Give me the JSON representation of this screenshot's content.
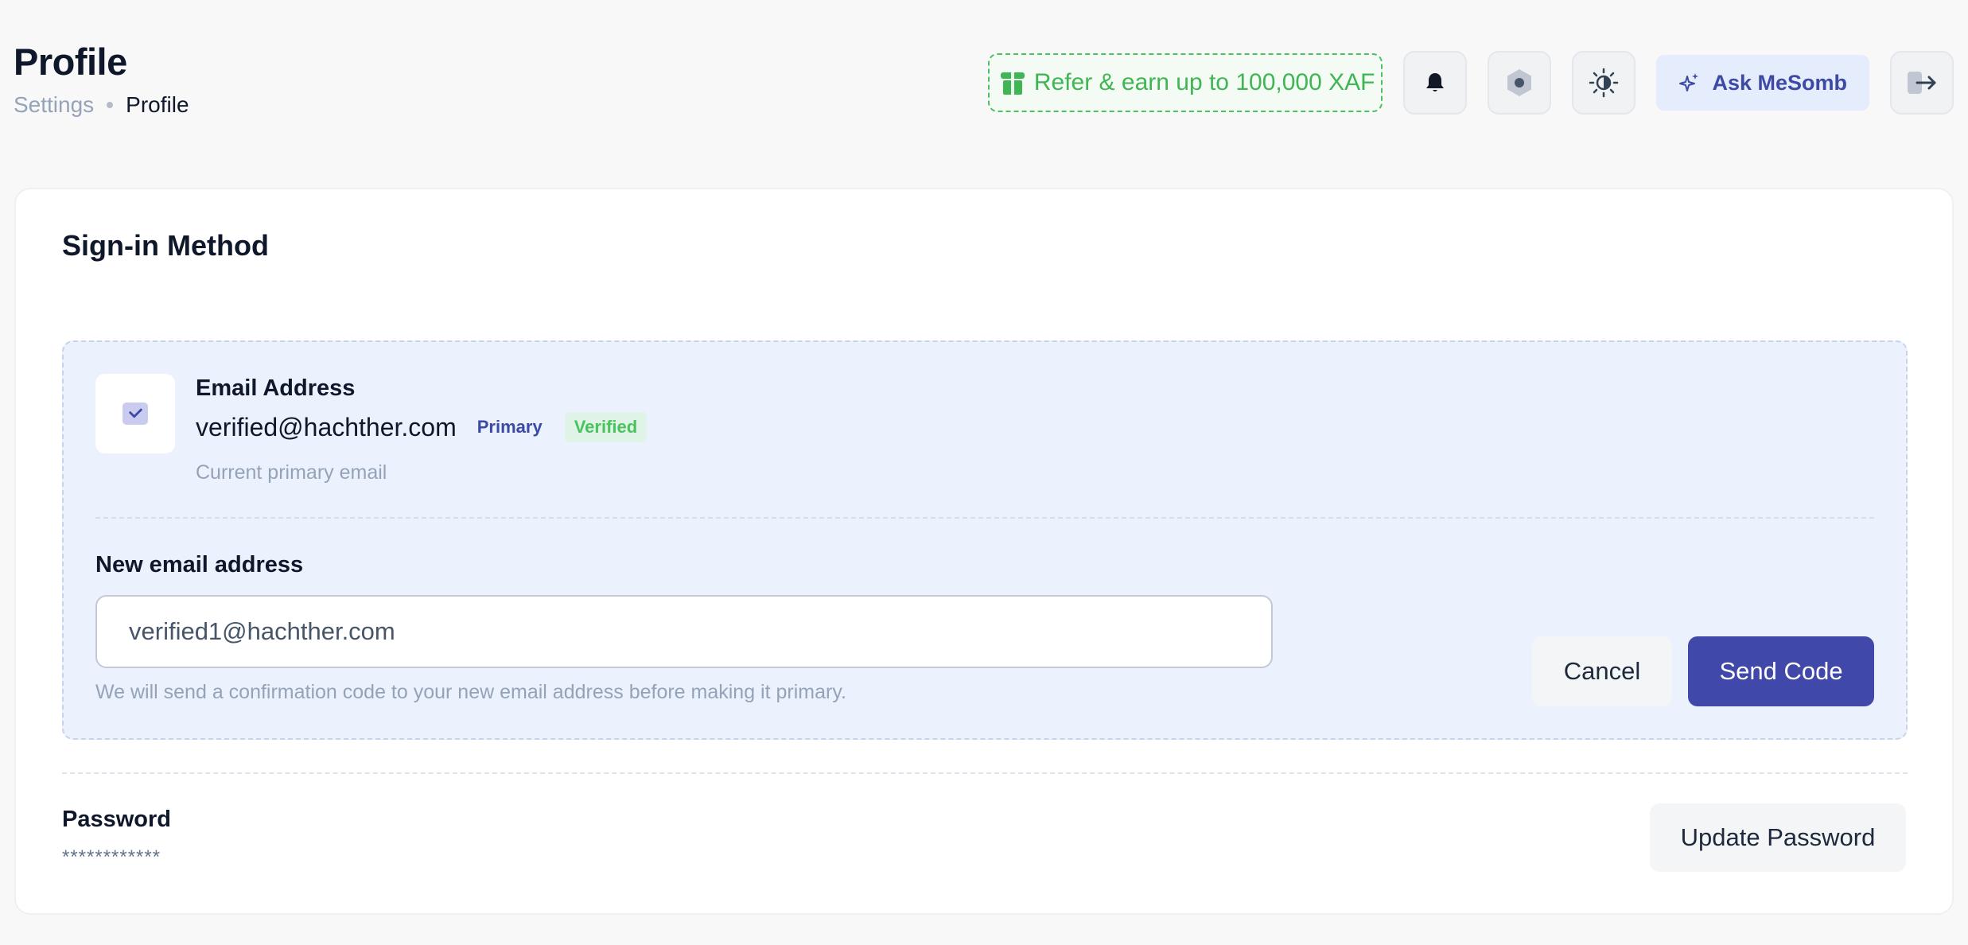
{
  "header": {
    "title": "Profile",
    "breadcrumb": {
      "parent": "Settings",
      "current": "Profile"
    },
    "refer": {
      "label": "Refer & earn up to 100,000 XAF",
      "icon": "gift-icon",
      "color": "#3fb653"
    },
    "icons": [
      "bell-icon",
      "settings-hexagon-icon",
      "theme-sun-icon"
    ],
    "ask": {
      "label": "Ask MeSomb",
      "icon": "sparkles-icon"
    },
    "logout_icon": "logout-icon"
  },
  "signin": {
    "title": "Sign-in Method",
    "email": {
      "label": "Email Address",
      "value": "verified@hachther.com",
      "badge_primary": "Primary",
      "badge_verified": "Verified",
      "help": "Current primary email",
      "icon": "mail-icon"
    },
    "new_email": {
      "label": "New email address",
      "value": "verified1@hachther.com",
      "hint": "We will send a confirmation code to your new email address before making it primary."
    },
    "cancel_label": "Cancel",
    "send_label": "Send Code",
    "password": {
      "label": "Password",
      "value": "************",
      "update_label": "Update Password"
    }
  },
  "colors": {
    "accent": "#4048aa",
    "success": "#4ac25d",
    "panel_bg": "#ebf1fd"
  }
}
